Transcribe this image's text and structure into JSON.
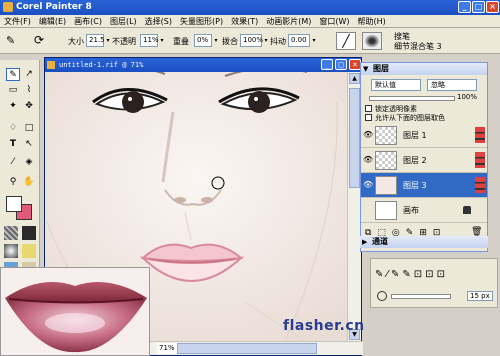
{
  "app": {
    "title": "Corel Painter 8"
  },
  "menu": [
    "文件(F)",
    "编辑(E)",
    "画布(C)",
    "图层(L)",
    "选择(S)",
    "矢量图形(P)",
    "效果(T)",
    "动画影片(M)",
    "窗口(W)",
    "帮助(H)"
  ],
  "propbar": {
    "size_label": "大小",
    "size_value": "21.5",
    "opacity_label": "不透明",
    "opacity_value": "11%",
    "resat_label": "重叠",
    "resat_value": "0%",
    "bleed_label": "拨合",
    "bleed_value": "100%",
    "jitter_label": "抖动",
    "jitter_value": "0.00",
    "brush_category": "搜笔",
    "brush_variant": "细节混合笔 3"
  },
  "document": {
    "title": "untitled-1.rif @ 71%",
    "zoom": "71%"
  },
  "layers_panel": {
    "title": "图层",
    "composite_method": "默认值",
    "composite_depth": "忽略",
    "opacity": "100%",
    "opt_preserve": "锁定透明像素",
    "opt_pickup": "允许从下面的图层取色",
    "layers": [
      {
        "name": "图层 1",
        "active": false
      },
      {
        "name": "图层 2",
        "active": false
      },
      {
        "name": "图层 3",
        "active": true
      },
      {
        "name": "画布",
        "active": false
      }
    ]
  },
  "channels_panel": {
    "title": "通道"
  },
  "color_panel": {
    "size_value": "15 px"
  },
  "watermark": "flasher.cn"
}
